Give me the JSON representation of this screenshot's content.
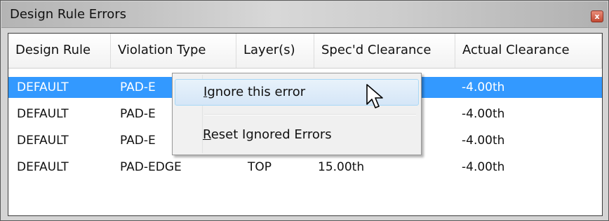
{
  "window": {
    "title": "Design Rule Errors",
    "close_glyph": "x"
  },
  "table": {
    "columns": [
      "Design Rule",
      "Violation Type",
      "Layer(s)",
      "Spec'd Clearance",
      "Actual Clearance"
    ],
    "rows": [
      {
        "design_rule": "DEFAULT",
        "violation_type": "PAD-E",
        "layers": "",
        "specd_clearance": "",
        "actual_clearance": "-4.00th",
        "selected": true
      },
      {
        "design_rule": "DEFAULT",
        "violation_type": "PAD-E",
        "layers": "",
        "specd_clearance": "",
        "actual_clearance": "-4.00th",
        "selected": false
      },
      {
        "design_rule": "DEFAULT",
        "violation_type": "PAD-E",
        "layers": "",
        "specd_clearance": "",
        "actual_clearance": "-4.00th",
        "selected": false
      },
      {
        "design_rule": "DEFAULT",
        "violation_type": "PAD-EDGE",
        "layers": "TOP",
        "specd_clearance": "15.00th",
        "actual_clearance": "-4.00th",
        "selected": false
      }
    ]
  },
  "context_menu": {
    "items": [
      {
        "label": "Ignore this error",
        "underline_char": "I",
        "highlighted": true
      },
      {
        "label": "Reset Ignored Errors",
        "underline_char": "R",
        "highlighted": false
      }
    ]
  },
  "colors": {
    "selection": "#3399ff",
    "menu_hover": "#d5e6f7",
    "window_bg": "#d4d4d4"
  },
  "icons": {
    "close": "close-icon",
    "cursor": "mouse-pointer-icon"
  }
}
